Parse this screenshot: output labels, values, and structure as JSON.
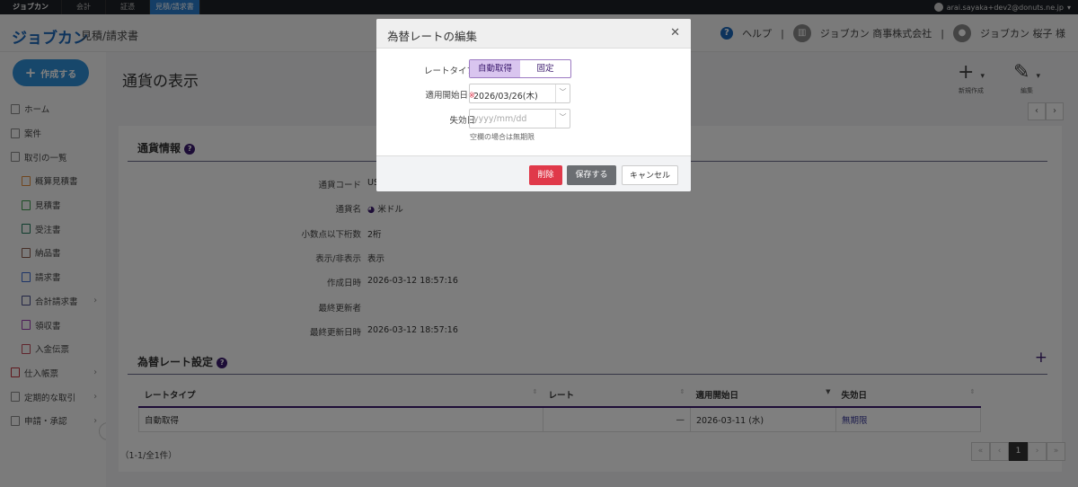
{
  "topbar": {
    "brand": "ジョブカン",
    "tabs": [
      "会計",
      "証憑",
      "見積/請求書"
    ],
    "account": "arai.sayaka+dev2@donuts.ne.jp"
  },
  "header": {
    "logo": "ジョブカン",
    "product": "見積/請求書",
    "help": "ヘルプ",
    "company": "ジョブカン 商事株式会社",
    "user": "ジョブカン 桜子 様"
  },
  "sidebar": {
    "create": "作成する",
    "items": [
      {
        "label": "ホーム",
        "sub": false,
        "color": "#888"
      },
      {
        "label": "案件",
        "sub": false,
        "color": "#888"
      },
      {
        "label": "取引の一覧",
        "sub": false,
        "color": "#888"
      },
      {
        "label": "概算見積書",
        "sub": true,
        "color": "#e08a3a"
      },
      {
        "label": "見積書",
        "sub": true,
        "color": "#3a9a4a"
      },
      {
        "label": "受注書",
        "sub": true,
        "color": "#1f7a5a"
      },
      {
        "label": "納品書",
        "sub": true,
        "color": "#8a5a4a"
      },
      {
        "label": "請求書",
        "sub": true,
        "color": "#3a6ad0"
      },
      {
        "label": "合計請求書",
        "sub": true,
        "color": "#444a8a",
        "chev": true
      },
      {
        "label": "領収書",
        "sub": true,
        "color": "#9a3ab0"
      },
      {
        "label": "入金伝票",
        "sub": true,
        "color": "#c04a5a"
      },
      {
        "label": "仕入帳票",
        "sub": false,
        "color": "#c0303a",
        "chev": true
      },
      {
        "label": "定期的な取引",
        "sub": false,
        "color": "#888",
        "chev": true
      },
      {
        "label": "申請・承認",
        "sub": false,
        "color": "#888",
        "chev": true
      }
    ]
  },
  "page": {
    "title": "通貨の表示",
    "new": "新規作成",
    "edit": "編集"
  },
  "currency": {
    "title": "通貨情報",
    "rows": [
      {
        "k": "通貨コード",
        "v": "US"
      },
      {
        "k": "通貨名",
        "v": "米ドル"
      },
      {
        "k": "小数点以下桁数",
        "v": "2桁"
      },
      {
        "k": "表示/非表示",
        "v": "表示"
      },
      {
        "k": "作成日時",
        "v": "2026-03-12 18:57:16"
      },
      {
        "k": "最終更新者",
        "v": ""
      },
      {
        "k": "最終更新日時",
        "v": "2026-03-12 18:57:16"
      }
    ]
  },
  "rates": {
    "title": "為替レート設定",
    "headers": [
      "レートタイプ",
      "レート",
      "適用開始日",
      "失効日"
    ],
    "rows": [
      [
        "自動取得",
        "—",
        "2026-03-11 (水)",
        "無期限"
      ]
    ],
    "count": "（1-1/全1件）",
    "page": "1"
  },
  "modal": {
    "title": "為替レートの編集",
    "rate_type_label": "レートタイプ",
    "options": [
      "自動取得",
      "固定"
    ],
    "selected": "自動取得",
    "start_label": "適用開始日",
    "start_value": "2026/03/26(木)",
    "end_label": "失効日",
    "end_placeholder": "yyyy/mm/dd",
    "hint": "空欄の場合は無期限",
    "delete": "削除",
    "save": "保存する",
    "cancel": "キャンセル"
  }
}
